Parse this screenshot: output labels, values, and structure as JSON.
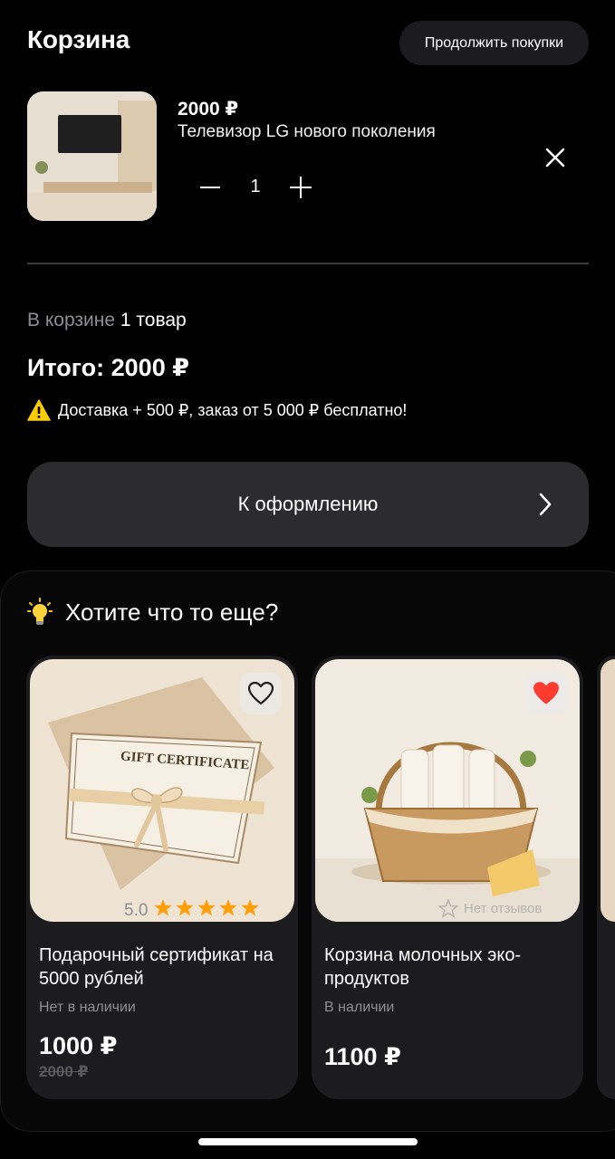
{
  "header": {
    "title": "Корзина",
    "continue_label": "Продолжить покупки"
  },
  "cart_item": {
    "price": "2000 ₽",
    "name": "Телевизор LG нового поколения",
    "quantity": "1"
  },
  "summary": {
    "count_prefix": "В корзине",
    "count_value": "1 товар",
    "total": "Итого: 2000 ₽",
    "delivery_note": "Доставка + 500 ₽, заказ от 5 000 ₽ бесплатно!"
  },
  "checkout": {
    "label": "К оформлению"
  },
  "recommendations": {
    "heading": "Хотите что то еще?",
    "items": [
      {
        "title": "Подарочный сертификат на 5000 рублей",
        "stock": "Нет в наличии",
        "price": "1000 ₽",
        "old_price": "2000 ₽",
        "rating": "5.0",
        "stars": 5,
        "favorite": false,
        "image_text": "GIFT CERTIFICATE"
      },
      {
        "title": "Корзина молочных эко-продуктов",
        "stock": "В наличии",
        "price": "1100 ₽",
        "reviews_label": "Нет отзывов",
        "favorite": true
      }
    ]
  },
  "colors": {
    "background": "#000000",
    "surface": "#1c1c1e",
    "accent_star": "#ff9f0a",
    "favorite_red": "#ff3b30",
    "muted_text": "#8e8e93"
  }
}
